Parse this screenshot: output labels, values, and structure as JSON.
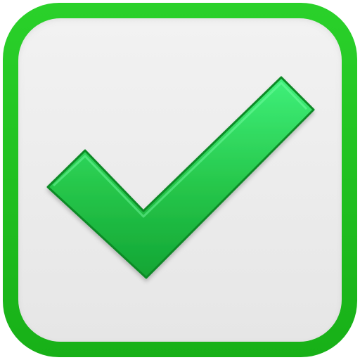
{
  "icon": {
    "name": "checkmark-icon",
    "state": "checked"
  },
  "colors": {
    "frame_green": "#1fc21f",
    "frame_green_dark": "#14a514",
    "inner_fill": "#ececec",
    "check_green": "#26c64a",
    "check_green_light": "#3ff07a",
    "check_green_dark": "#0e9a2e",
    "check_outline": "#0b8a28"
  }
}
